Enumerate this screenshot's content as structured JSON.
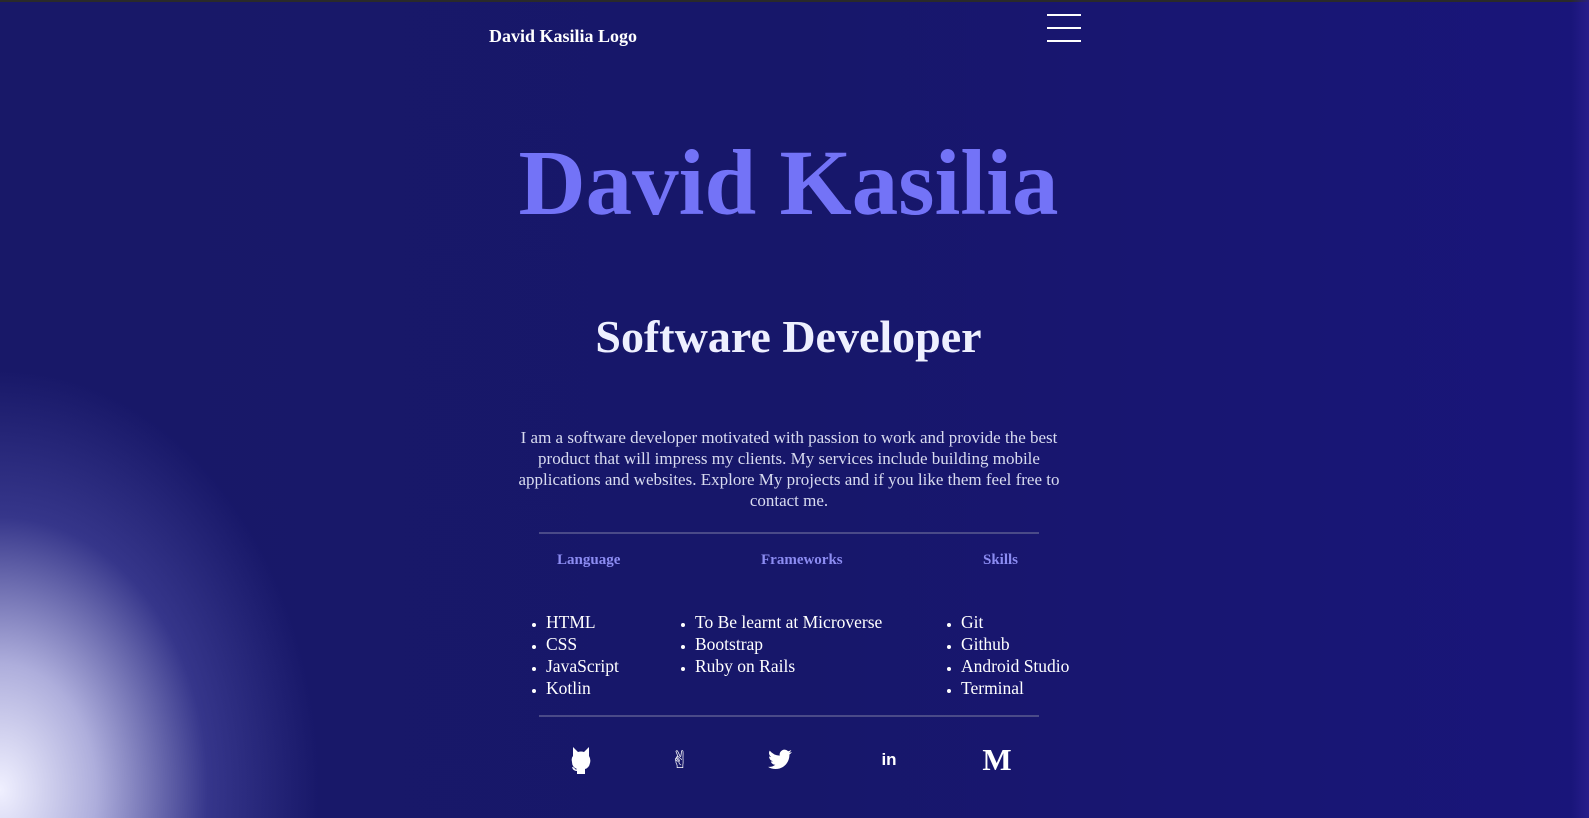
{
  "header": {
    "logo_text": "David Kasilia Logo",
    "menu_icon": "hamburger-menu-icon"
  },
  "hero": {
    "name": "David Kasilia",
    "role": "Software Developer",
    "intro": "I am a software developer motivated with passion to work and provide the best product that will impress my clients. My services include building mobile applications and websites. Explore My projects and if you like them feel free to contact me."
  },
  "skills": {
    "columns": [
      {
        "heading": "Language",
        "items": [
          "HTML",
          "CSS",
          "JavaScript",
          "Kotlin"
        ]
      },
      {
        "heading": "Frameworks",
        "items": [
          "To Be learnt at Microverse",
          "Bootstrap",
          "Ruby on Rails"
        ]
      },
      {
        "heading": "Skills",
        "items": [
          "Git",
          "Github",
          "Android Studio",
          "Terminal"
        ]
      }
    ]
  },
  "socials": {
    "icons": [
      "github-icon",
      "angellist-icon",
      "twitter-icon",
      "linkedin-icon",
      "medium-icon"
    ],
    "linkedin_label": "in",
    "medium_label": "M",
    "angellist_glyph": "✌"
  },
  "colors": {
    "background": "#17176a",
    "name": "#7373f7",
    "column_heading": "#8c8cf2",
    "text": "#ffffff",
    "divider": "#4a4a88"
  }
}
